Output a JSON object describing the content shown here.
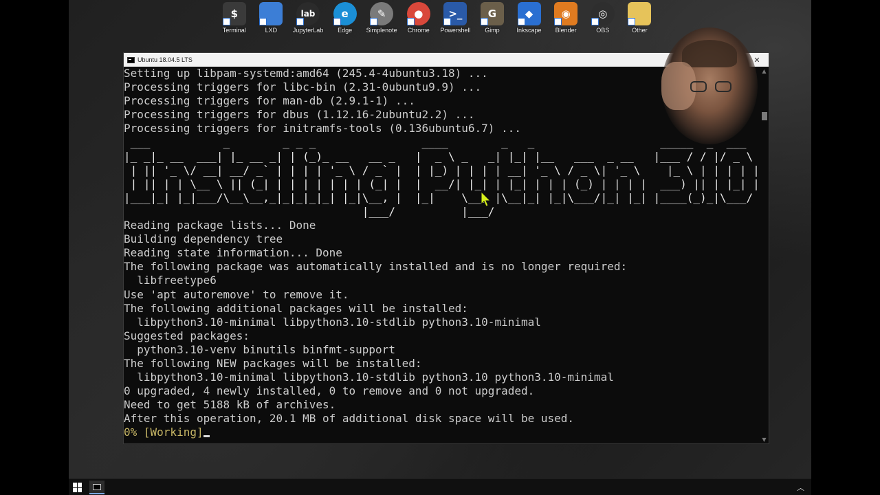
{
  "desktop_icons": [
    {
      "label": "Terminal",
      "icon": "terminal-icon",
      "glyph": "$",
      "color": "#3a3a3a"
    },
    {
      "label": "LXD",
      "icon": "lxd-icon",
      "glyph": "",
      "color": "#3c7ed6"
    },
    {
      "label": "JupyterLab",
      "icon": "jupyterlab-icon",
      "glyph": "lab",
      "color": "#2b2b2b"
    },
    {
      "label": "Edge",
      "icon": "edge-icon",
      "glyph": "e",
      "color": "#1b8fd6"
    },
    {
      "label": "Simplenote",
      "icon": "simplenote-icon",
      "glyph": "✎",
      "color": "#7a7a7a"
    },
    {
      "label": "Chrome",
      "icon": "chrome-icon",
      "glyph": "●",
      "color": "#d9483b"
    },
    {
      "label": "Powershell",
      "icon": "powershell-icon",
      "glyph": ">_",
      "color": "#2a5aa8"
    },
    {
      "label": "Gimp",
      "icon": "gimp-icon",
      "glyph": "G",
      "color": "#6b5f4a"
    },
    {
      "label": "Inkscape",
      "icon": "inkscape-icon",
      "glyph": "◆",
      "color": "#2a6fd1"
    },
    {
      "label": "Blender",
      "icon": "blender-icon",
      "glyph": "◉",
      "color": "#e07b20"
    },
    {
      "label": "OBS",
      "icon": "obs-icon",
      "glyph": "◎",
      "color": "#2e2e2e"
    },
    {
      "label": "Other",
      "icon": "folder-icon",
      "glyph": "",
      "color": "#e6c35a"
    }
  ],
  "window": {
    "title": "Ubuntu 18.04.5 LTS",
    "min": "—",
    "max": "☐",
    "close": "✕"
  },
  "terminal": {
    "lines_before": [
      "Setting up libpam-systemd:amd64 (245.4-4ubuntu3.18) ...",
      "Processing triggers for libc-bin (2.31-0ubuntu9.9) ...",
      "Processing triggers for man-db (2.9.1-1) ...",
      "Processing triggers for dbus (1.12.16-2ubuntu2.2) ...",
      "Processing triggers for initramfs-tools (0.136ubuntu6.7) ..."
    ],
    "banner": [
      " ___           _        _ _ _                ____        _   _                   _____  _  ___  ",
      "|_ _|_ __  ___| |_ __ _| | (_)_ __   __ _   |  _ \\ _   _| |_| |__   ___  _ __   |___ / / |/ _ \\ ",
      " | || '_ \\/ __| __/ _` | | | | '_ \\ / _` |  | |_) | | | | __| '_ \\ / _ \\| '_ \\    |_ \\ | | | | |",
      " | || | | \\__ \\ || (_| | | | | | | | (_| |  |  __/| |_| | |_| | | | (_) | | | |  ___) || | |_| |",
      "|___|_| |_|___/\\__\\__,_|_|_|_|_| |_|\\__, |  |_|    \\__, |\\__|_| |_|\\___/|_| |_| |____(_)_|\\___/ ",
      "                                    |___/          |___/                                        "
    ],
    "lines_after": [
      "Reading package lists... Done",
      "Building dependency tree",
      "Reading state information... Done",
      "The following package was automatically installed and is no longer required:",
      "  libfreetype6",
      "Use 'apt autoremove' to remove it.",
      "The following additional packages will be installed:",
      "  libpython3.10-minimal libpython3.10-stdlib python3.10-minimal",
      "Suggested packages:",
      "  python3.10-venv binutils binfmt-support",
      "The following NEW packages will be installed:",
      "  libpython3.10-minimal libpython3.10-stdlib python3.10 python3.10-minimal",
      "0 upgraded, 4 newly installed, 0 to remove and 0 not upgraded.",
      "Need to get 5188 kB of archives.",
      "After this operation, 20.1 MB of additional disk space will be used."
    ],
    "progress_line": "0% [Working]"
  },
  "colors": {
    "terminal_bg": "#0c0c0c",
    "terminal_fg": "#cccccc",
    "progress_fg": "#c8b766",
    "cursor_arrow": "#d6f01a"
  }
}
